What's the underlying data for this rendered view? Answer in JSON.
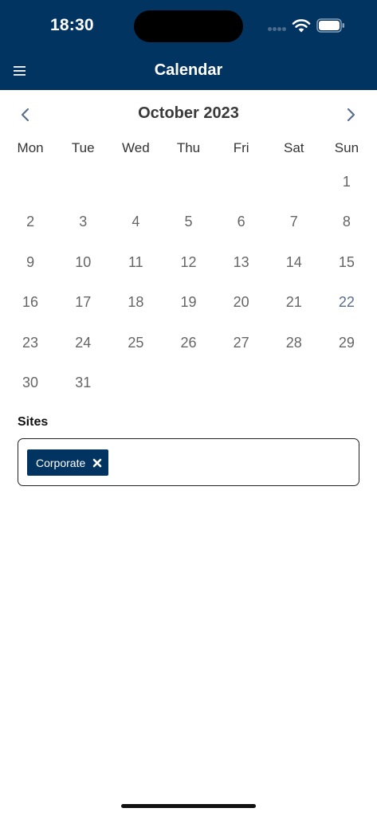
{
  "status_bar": {
    "time": "18:30"
  },
  "header": {
    "title": "Calendar",
    "menu_icon": "hamburger-menu-icon",
    "background_color": "#023461"
  },
  "calendar": {
    "month_label": "October 2023",
    "prev_icon": "chevron-left-icon",
    "next_icon": "chevron-right-icon",
    "weekdays": [
      "Mon",
      "Tue",
      "Wed",
      "Thu",
      "Fri",
      "Sat",
      "Sun"
    ],
    "leading_blanks": 6,
    "days": [
      "1",
      "2",
      "3",
      "4",
      "5",
      "6",
      "7",
      "8",
      "9",
      "10",
      "11",
      "12",
      "13",
      "14",
      "15",
      "16",
      "17",
      "18",
      "19",
      "20",
      "21",
      "22",
      "23",
      "24",
      "25",
      "26",
      "27",
      "28",
      "29",
      "30",
      "31"
    ],
    "highlighted_day": "22",
    "highlight_color": "#5a6e8c"
  },
  "sites": {
    "label": "Sites",
    "chips": [
      {
        "label": "Corporate",
        "remove_icon": "close-x-icon"
      }
    ],
    "chip_color": "#023461"
  }
}
